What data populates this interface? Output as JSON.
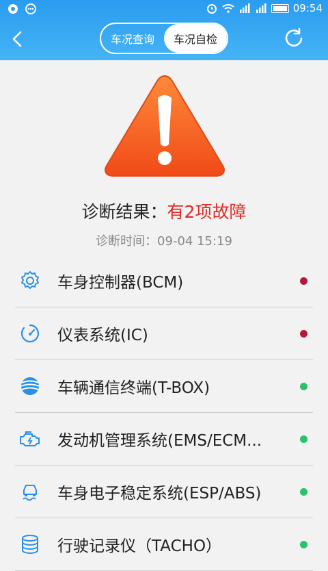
{
  "status_bar": {
    "time": "09:54"
  },
  "header": {
    "tabs": [
      {
        "label": "车况查询",
        "active": false
      },
      {
        "label": "车况自检",
        "active": true
      }
    ]
  },
  "diagnosis": {
    "result_prefix": "诊断结果：",
    "result_value": "有2项故障",
    "time_text": "诊断时间：09-04 15:19"
  },
  "colors": {
    "fault": "#b3173b",
    "ok": "#27c26a",
    "accent": "#2a9cf0"
  },
  "systems": [
    {
      "label": "车身控制器(BCM)",
      "icon": "gear-icon",
      "status": "fault"
    },
    {
      "label": "仪表系统(IC)",
      "icon": "gauge-icon",
      "status": "fault"
    },
    {
      "label": "车辆通信终端(T-BOX)",
      "icon": "globe-icon",
      "status": "ok"
    },
    {
      "label": "发动机管理系统(EMS/ECM...",
      "icon": "engine-icon",
      "status": "ok"
    },
    {
      "label": "车身电子稳定系统(ESP/ABS)",
      "icon": "car-stability-icon",
      "status": "ok"
    },
    {
      "label": "行驶记录仪（TACHO）",
      "icon": "database-icon",
      "status": "ok"
    }
  ]
}
